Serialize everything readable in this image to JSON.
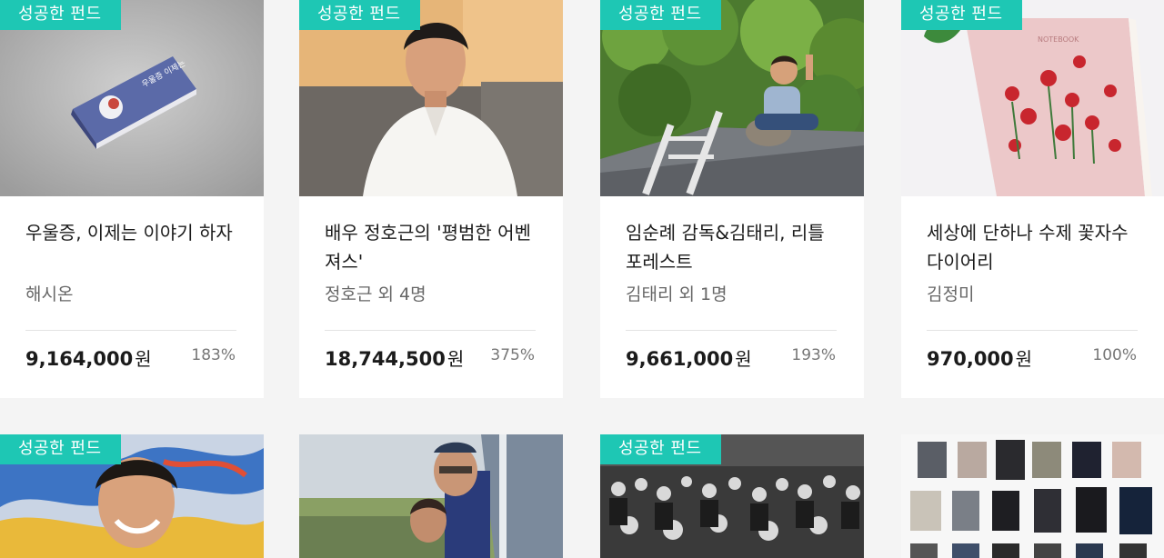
{
  "badge_label": "성공한 펀드",
  "currency_unit": "원",
  "cards": [
    {
      "title": "우울증, 이제는 이야기 하자",
      "author": "해시온",
      "amount": "9,164,000",
      "percent": "183%",
      "book_label": "우울증 이제는"
    },
    {
      "title": "배우 정호근의 '평범한 어벤져스'",
      "author": "정호근 외 4명",
      "amount": "18,744,500",
      "percent": "375%"
    },
    {
      "title": "임순례 감독&김태리, 리틀 포레스트",
      "author": "김태리 외 1명",
      "amount": "9,661,000",
      "percent": "193%"
    },
    {
      "title": "세상에 단하나 수제 꽃자수 다이어리",
      "author": "김정미",
      "amount": "970,000",
      "percent": "100%",
      "diary_label": "NOTEBOOK"
    }
  ],
  "row2": [
    {
      "has_badge": true
    },
    {
      "has_badge": false
    },
    {
      "has_badge": true
    },
    {
      "has_badge": false
    }
  ]
}
